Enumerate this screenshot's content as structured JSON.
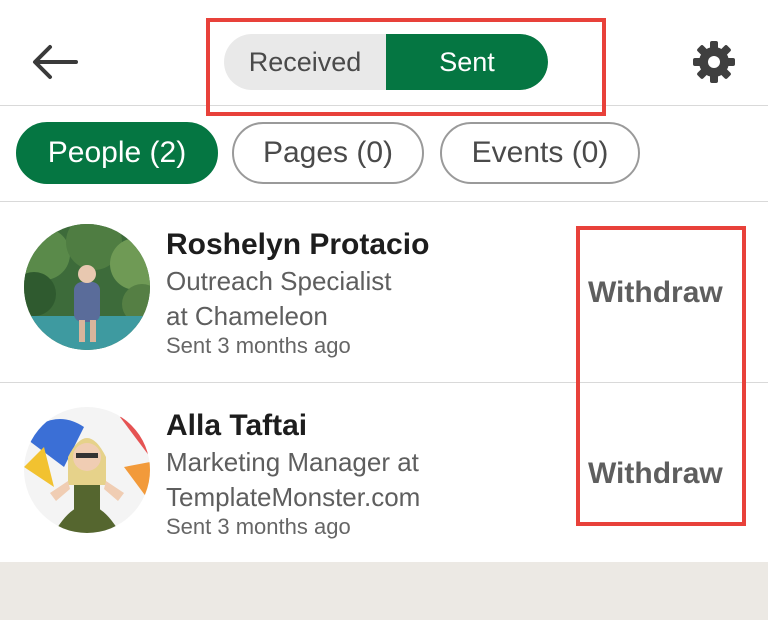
{
  "header": {
    "back_icon": "arrow-left-icon",
    "settings_icon": "gear-icon",
    "segments": [
      "Received",
      "Sent"
    ],
    "active_segment": "Sent"
  },
  "filters": [
    {
      "label": "People (2)",
      "active": true
    },
    {
      "label": "Pages (0)",
      "active": false
    },
    {
      "label": "Events (0)",
      "active": false
    }
  ],
  "invitations": [
    {
      "name": "Roshelyn Protacio",
      "headline_line1": "Outreach Specialist",
      "headline_line2": "at Chameleon",
      "sent": "Sent 3 months ago",
      "action": "Withdraw"
    },
    {
      "name": "Alla Taftai",
      "headline_line1": "Marketing Manager at",
      "headline_line2": "TemplateMonster.com",
      "sent": "Sent 3 months ago",
      "action": "Withdraw"
    }
  ],
  "colors": {
    "brand_green": "#057642",
    "annotation_red": "#e8413a",
    "segment_bg": "#e9e9e9",
    "footer_band": "#ece9e4"
  }
}
